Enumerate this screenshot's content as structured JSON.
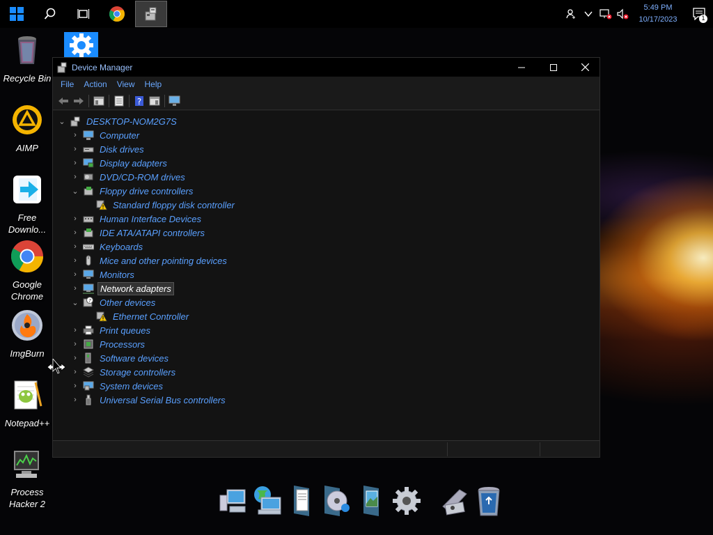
{
  "taskbar": {
    "clock_time": "5:49 PM",
    "clock_date": "10/17/2023",
    "notification_count": "1"
  },
  "desktop": {
    "icons": [
      {
        "label": "Recycle Bin"
      },
      {
        "label": "AIMP"
      },
      {
        "label": "Free Downlo..."
      },
      {
        "label": "Google Chrome"
      },
      {
        "label": "ImgBurn"
      },
      {
        "label": "Notepad++"
      },
      {
        "label": "Process Hacker 2"
      }
    ]
  },
  "window": {
    "title": "Device Manager",
    "menu": [
      "File",
      "Action",
      "View",
      "Help"
    ],
    "tree": {
      "root": "DESKTOP-NOM2G7S",
      "items": [
        {
          "label": "Computer",
          "expanded": false
        },
        {
          "label": "Disk drives",
          "expanded": false
        },
        {
          "label": "Display adapters",
          "expanded": false
        },
        {
          "label": "DVD/CD-ROM drives",
          "expanded": false
        },
        {
          "label": "Floppy drive controllers",
          "expanded": true
        },
        {
          "label": "Standard floppy disk controller",
          "child": true
        },
        {
          "label": "Human Interface Devices",
          "expanded": false
        },
        {
          "label": "IDE ATA/ATAPI controllers",
          "expanded": false
        },
        {
          "label": "Keyboards",
          "expanded": false
        },
        {
          "label": "Mice and other pointing devices",
          "expanded": false
        },
        {
          "label": "Monitors",
          "expanded": false
        },
        {
          "label": "Network adapters",
          "expanded": false,
          "selected": true
        },
        {
          "label": "Other devices",
          "expanded": true
        },
        {
          "label": "Ethernet Controller",
          "child": true
        },
        {
          "label": "Print queues",
          "expanded": false
        },
        {
          "label": "Processors",
          "expanded": false
        },
        {
          "label": "Software devices",
          "expanded": false
        },
        {
          "label": "Storage controllers",
          "expanded": false
        },
        {
          "label": "System devices",
          "expanded": false
        },
        {
          "label": "Universal Serial Bus controllers",
          "expanded": false
        }
      ]
    }
  },
  "colors": {
    "link_blue": "#5aa0ff",
    "accent": "#1a8cff"
  }
}
